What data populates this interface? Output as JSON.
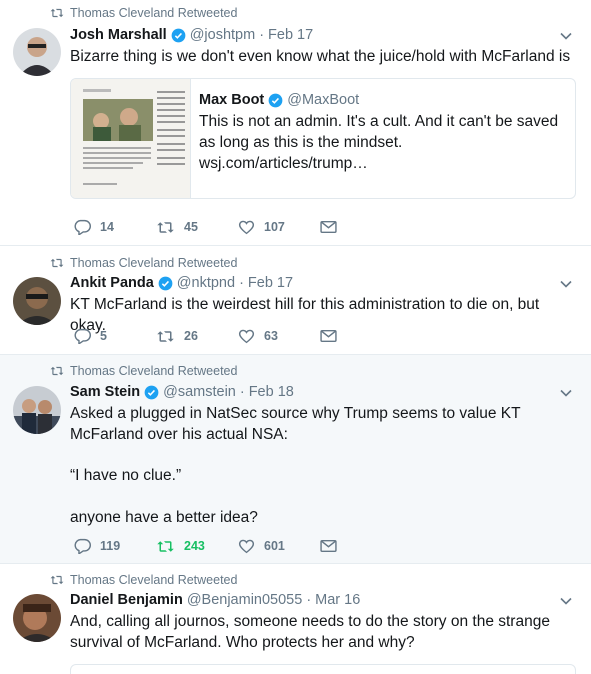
{
  "tweets": [
    {
      "retweeted_by": "Thomas Cleveland Retweeted",
      "name": "Josh Marshall",
      "handle": "@joshtpm",
      "time": "Feb 17",
      "text": "Bizarre thing is we don't even know what the juice/hold with McFarland is",
      "quote": {
        "name": "Max Boot",
        "handle": "@MaxBoot",
        "text": "This is not an admin. It's a cult. And it can't be saved as long as this is the mindset. wsj.com/articles/trump…"
      },
      "replies": "14",
      "retweets": "45",
      "likes": "107"
    },
    {
      "retweeted_by": "Thomas Cleveland Retweeted",
      "name": "Ankit Panda",
      "handle": "@nktpnd",
      "time": "Feb 17",
      "text": "KT McFarland is the weirdest hill for this administration to die on, but okay.",
      "replies": "5",
      "retweets": "26",
      "likes": "63"
    },
    {
      "retweeted_by": "Thomas Cleveland Retweeted",
      "name": "Sam Stein",
      "handle": "@samstein",
      "time": "Feb 18",
      "text_lines": [
        "Asked a plugged in NatSec source why Trump seems to value KT McFarland over his actual NSA:",
        "“I have no clue.”",
        "anyone have a better idea?"
      ],
      "replies": "119",
      "retweets": "243",
      "likes": "601"
    },
    {
      "retweeted_by": "Thomas Cleveland Retweeted",
      "name": "Daniel Benjamin",
      "handle": "@Benjamin05055",
      "time": "Mar 16",
      "text": "And, calling all journos, someone needs to do the story on the strange survival of McFarland.  Who protects her and why?"
    }
  ],
  "colors": {
    "secondary_text": "#657786",
    "verified": "#1da1f2",
    "retweet_active": "#17bf63",
    "divider": "#e6ecf0",
    "highlight_bg": "#f5f8fa"
  },
  "icons": [
    "retweet-icon",
    "verified-badge-icon",
    "chevron-down-icon",
    "reply-icon",
    "like-icon",
    "direct-message-icon"
  ]
}
